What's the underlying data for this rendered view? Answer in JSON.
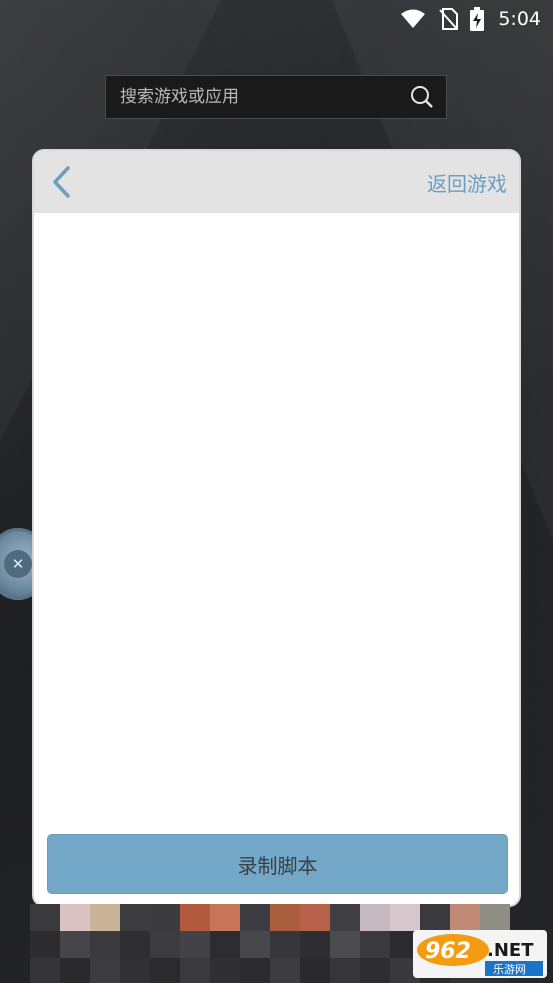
{
  "status_bar": {
    "time": "5:04",
    "icons": [
      "wifi-icon",
      "no-sim-icon",
      "battery-charging-icon"
    ]
  },
  "search": {
    "placeholder": "搜索游戏或应用",
    "value": "",
    "icon": "search-icon"
  },
  "floating_button": {
    "icon": "close-icon"
  },
  "dialog": {
    "back_icon": "chevron-left-icon",
    "return_label": "返回游戏",
    "primary_button_label": "录制脚本"
  },
  "watermark": {
    "text_main": "962",
    "text_suffix": ".NET",
    "text_sub": "乐游网"
  },
  "colors": {
    "accent_button": "#74a8c9",
    "link": "#6d9ec1",
    "header_bg": "#e3e3e3",
    "background": "#1e1f22"
  }
}
